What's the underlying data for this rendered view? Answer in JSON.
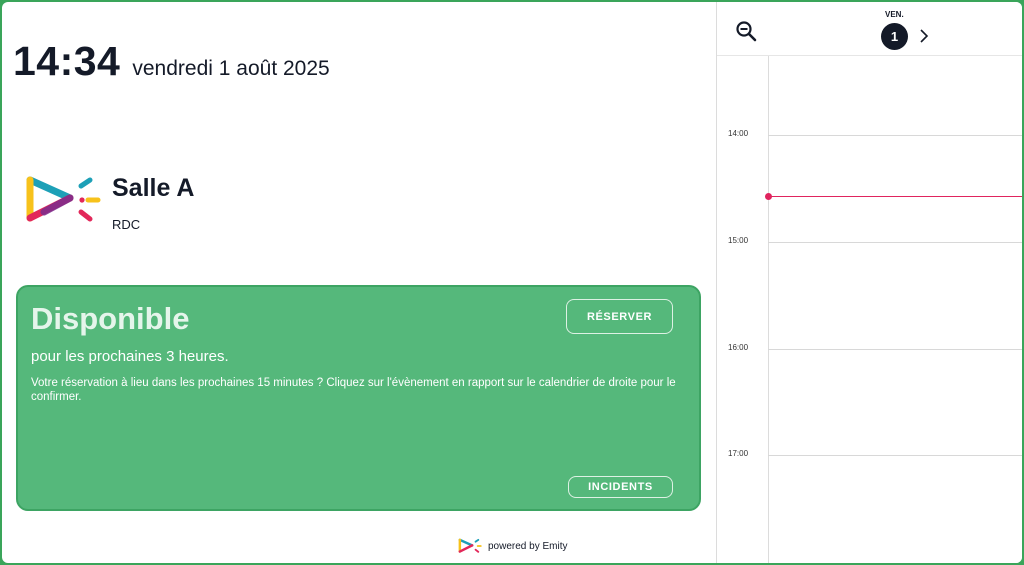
{
  "clock": {
    "time": "14:34",
    "date": "vendredi 1 août 2025"
  },
  "room": {
    "name": "Salle A",
    "floor": "RDC",
    "logo_icon": "emity-logo-icon"
  },
  "status": {
    "title": "Disponible",
    "subtitle": "pour les prochaines 3 heures.",
    "hint": "Votre réservation à lieu dans les prochaines 15 minutes ? Cliquez sur l'évènement en rapport sur le calendrier de droite pour le confirmer.",
    "reserve_label": "RÉSERVER",
    "incidents_label": "INCIDENTS",
    "color": "#55b87b"
  },
  "footer": {
    "powered": "powered by Emity"
  },
  "calendar": {
    "day_label": "VEN.",
    "day_number": "1",
    "hours": [
      "14:00",
      "15:00",
      "16:00",
      "17:00"
    ],
    "now_color": "#e0245e",
    "icons": {
      "zoom": "zoom-out-icon",
      "next": "chevron-right-icon"
    }
  }
}
